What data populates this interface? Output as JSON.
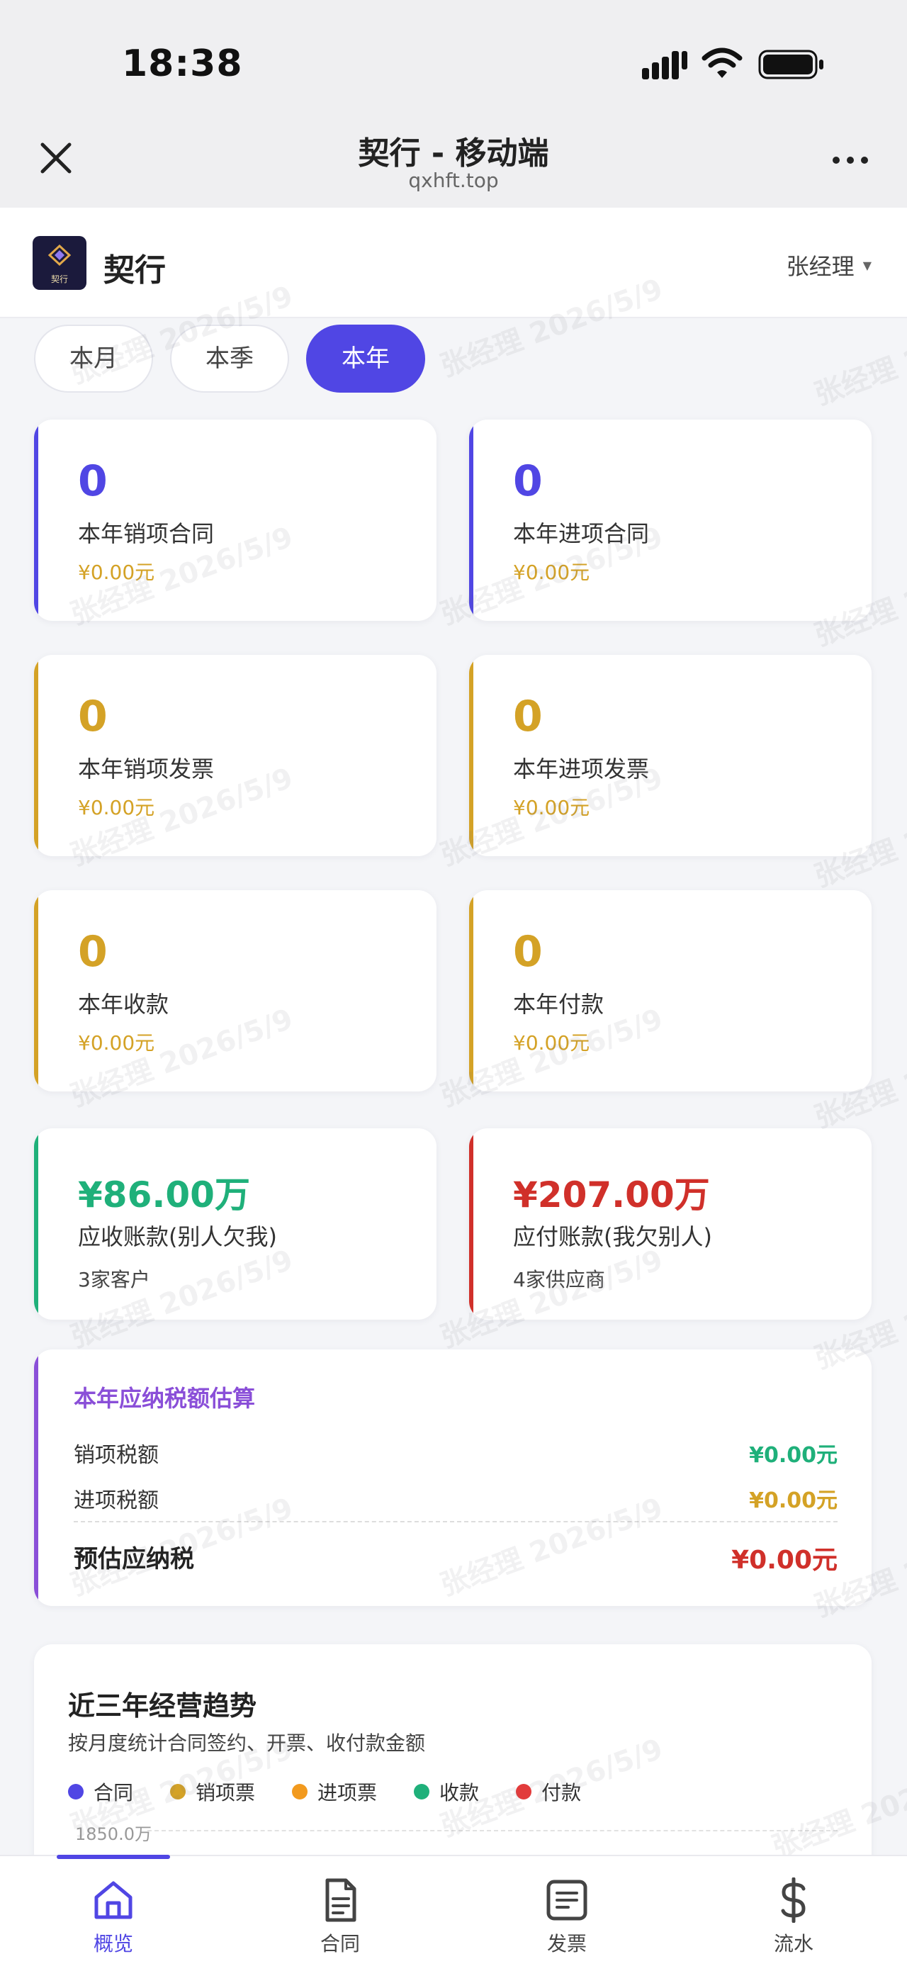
{
  "status": {
    "time": "18:38"
  },
  "webview": {
    "title": "契行 - 移动端",
    "url": "qxhft.top"
  },
  "app": {
    "name": "契行",
    "logo_text": "契行",
    "user": "张经理"
  },
  "periods": [
    "本月",
    "本季",
    "本年"
  ],
  "active_period": "本年",
  "stats": [
    {
      "value": "0",
      "label": "本年销项合同",
      "amount": "¥0.00元",
      "color": "#5046e4"
    },
    {
      "value": "0",
      "label": "本年进项合同",
      "amount": "¥0.00元",
      "color": "#5046e4"
    },
    {
      "value": "0",
      "label": "本年销项发票",
      "amount": "¥0.00元",
      "color": "#d4a226"
    },
    {
      "value": "0",
      "label": "本年进项发票",
      "amount": "¥0.00元",
      "color": "#d4a226"
    },
    {
      "value": "0",
      "label": "本年收款",
      "amount": "¥0.00元",
      "color": "#d4a226"
    },
    {
      "value": "0",
      "label": "本年付款",
      "amount": "¥0.00元",
      "color": "#d4a226"
    }
  ],
  "receivable": {
    "amount": "¥86.00万",
    "label": "应收账款(别人欠我)",
    "sub": "3家客户",
    "color": "#1fb07a"
  },
  "payable": {
    "amount": "¥207.00万",
    "label": "应付账款(我欠别人)",
    "sub": "4家供应商",
    "color": "#d0302a"
  },
  "tax": {
    "title": "本年应纳税额估算",
    "sales_label": "销项税额",
    "sales_value": "¥0.00元",
    "input_label": "进项税额",
    "input_value": "¥0.00元",
    "total_label": "预估应纳税",
    "total_value": "¥0.00元"
  },
  "trend": {
    "title": "近三年经营趋势",
    "subtitle": "按月度统计合同签约、开票、收付款金额",
    "legend": [
      {
        "name": "合同",
        "color": "#5046e4"
      },
      {
        "name": "销项票",
        "color": "#d4a226"
      },
      {
        "name": "进项票",
        "color": "#f29a1e"
      },
      {
        "name": "收款",
        "color": "#1fb07a"
      },
      {
        "name": "付款",
        "color": "#e23b3b"
      }
    ],
    "y_top_label": "1850.0万"
  },
  "watermark": "张经理 2026/5/9",
  "nav": [
    "概览",
    "合同",
    "发票",
    "流水"
  ],
  "active_nav": "概览"
}
